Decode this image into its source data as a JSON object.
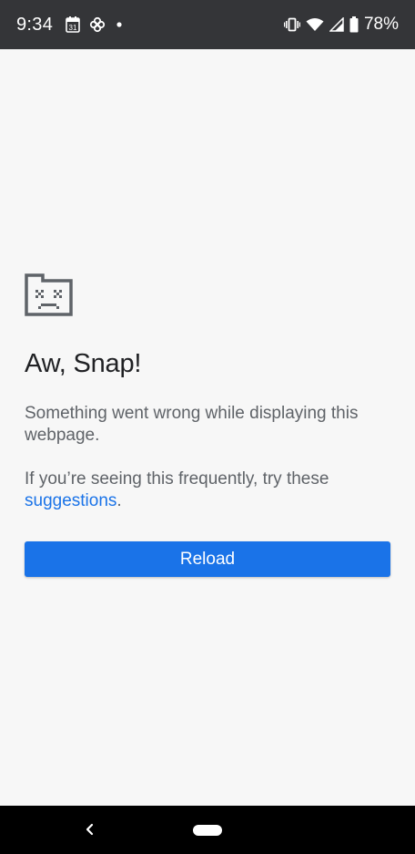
{
  "status_bar": {
    "time": "9:34",
    "battery_percent": "78%",
    "icons": [
      "calendar-icon",
      "pinwheel-icon",
      "notification-dot-icon",
      "vibrate-icon",
      "wifi-icon",
      "signal-icon",
      "battery-icon"
    ],
    "calendar_day": "31"
  },
  "error_page": {
    "icon": "sad-tab-icon",
    "title": "Aw, Snap!",
    "message": "Something went wrong while displaying this webpage.",
    "hint_prefix": "If you’re seeing this frequently, try these ",
    "hint_link": "suggestions",
    "hint_suffix": ".",
    "reload_label": "Reload"
  },
  "colors": {
    "accent": "#1a73e8",
    "status_bar_bg": "#343538",
    "page_bg": "#f7f7f7",
    "title_text": "#202124",
    "body_text": "#5f6368"
  },
  "nav_bar": {
    "icons": [
      "back-chevron-icon",
      "home-pill-icon"
    ]
  }
}
